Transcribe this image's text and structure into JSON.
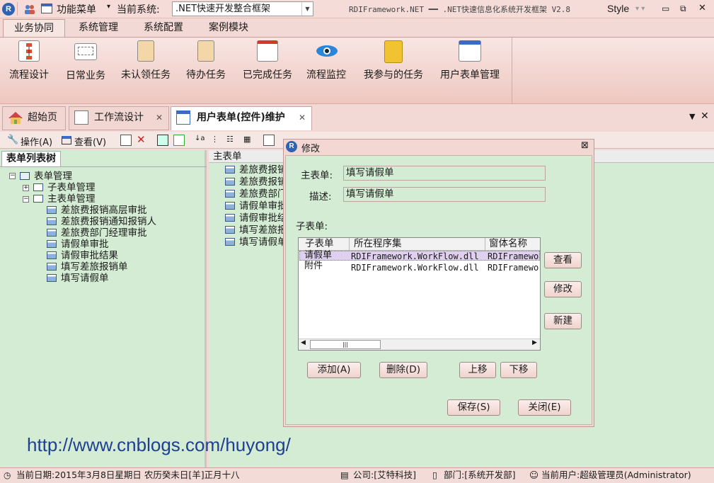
{
  "titlebar": {
    "func_menu": "功能菜单",
    "current_system_label": "当前系统:",
    "current_system_value": ".NET快速开发整合框架",
    "app_title": "RDIFramework.NET ━━ .NET快速信息化系统开发框架 V2.8",
    "style_label": "Style"
  },
  "ribbon": {
    "tabs": [
      "业务协同",
      "系统管理",
      "系统配置",
      "案例模块"
    ],
    "buttons": [
      "流程设计",
      "日常业务",
      "未认领任务",
      "待办任务",
      "已完成任务",
      "流程监控",
      "我参与的任务",
      "用户表单管理"
    ]
  },
  "doc_tabs": [
    "超始页",
    "工作流设计",
    "用户表单(控件)维护"
  ],
  "toolbar": {
    "operate": "操作(A)",
    "view": "查看(V)"
  },
  "left_panel": {
    "tab": "表单列表树",
    "root": "表单管理",
    "child1": "子表单管理",
    "child2": "主表单管理",
    "items": [
      "差旅费报销高层审批",
      "差旅费报销通知报销人",
      "差旅费部门经理审批",
      "请假单审批",
      "请假审批结果",
      "填写差旅报销单",
      "填写请假单"
    ]
  },
  "right_panel": {
    "header": "主表单",
    "items": [
      "差旅费报销",
      "差旅费报销",
      "差旅费部门",
      "请假单审批",
      "请假审批结",
      "填写差旅报",
      "填写请假单"
    ]
  },
  "watermark": "http://www.cnblogs.com/huyong/",
  "dialog": {
    "title": "修改",
    "main_form_label": "主表单:",
    "main_form_value": "填写请假单",
    "desc_label": "描述:",
    "desc_value": "填写请假单",
    "subform_label": "子表单:",
    "grid_headers": [
      "子表单",
      "所在程序集",
      "窗体名称"
    ],
    "grid_rows": [
      [
        "请假单",
        "RDIFramework.WorkFlow.dll",
        "RDIFramewo"
      ],
      [
        "附件",
        "RDIFramework.WorkFlow.dll",
        "RDIFramewo"
      ]
    ],
    "btn_view": "查看",
    "btn_edit": "修改",
    "btn_new": "新建",
    "btn_add": "添加(A)",
    "btn_delete": "删除(D)",
    "btn_up": "上移",
    "btn_down": "下移",
    "btn_save": "保存(S)",
    "btn_close": "关闭(E)"
  },
  "status": {
    "date": "当前日期:2015年3月8日星期日 农历癸未日[羊]正月十八",
    "company": "公司:[艾特科技]",
    "dept": "部门:[系统开发部]",
    "user": "当前用户:超级管理员(Administrator)"
  }
}
